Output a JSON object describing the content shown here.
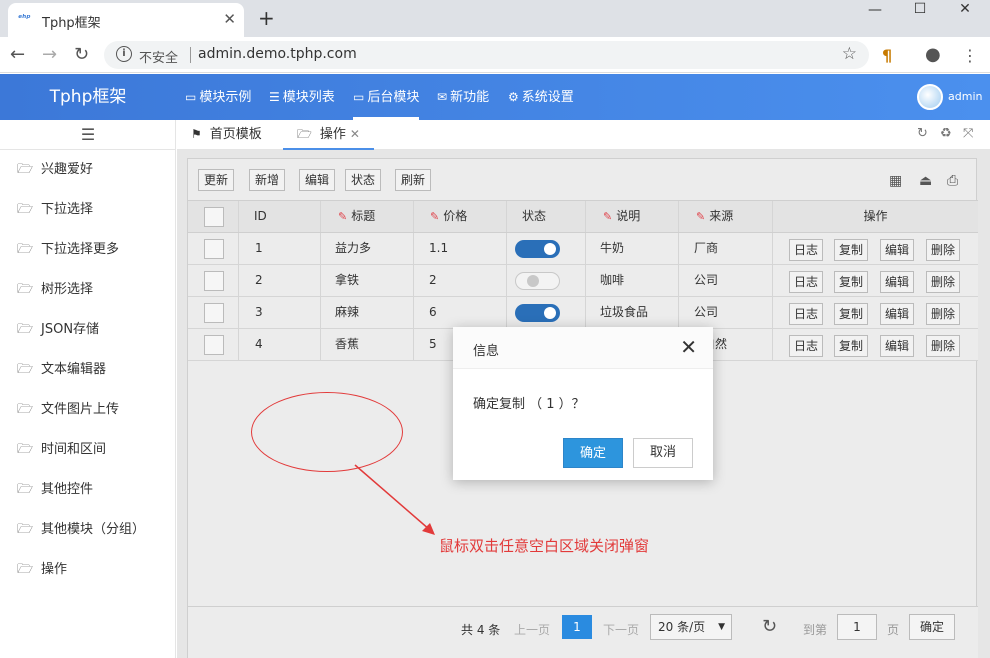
{
  "browser": {
    "tab_title": "Tphp框架",
    "tab_favicon": "ᵉʰᵖ",
    "new_tab": "+",
    "security_label": "不安全",
    "url": "admin.demo.tphp.com",
    "window_buttons": {
      "minimize": "—",
      "maximize": "☐",
      "close": "✕"
    }
  },
  "app": {
    "logo": "Tphp框架",
    "topnav": [
      {
        "label": "模块示例",
        "icon": "monitor-icon"
      },
      {
        "label": "模块列表",
        "icon": "list-icon"
      },
      {
        "label": "后台模块",
        "icon": "laptop-icon"
      },
      {
        "label": "新功能",
        "icon": "envelope-open-icon"
      },
      {
        "label": "系统设置",
        "icon": "gear-icon"
      }
    ],
    "active_topnav": "后台模块",
    "user": "admin",
    "accent_color": "#3c78d8"
  },
  "sidebar": {
    "items": [
      {
        "label": "兴趣爱好"
      },
      {
        "label": "下拉选择"
      },
      {
        "label": "下拉选择更多"
      },
      {
        "label": "树形选择"
      },
      {
        "label": "JSON存储"
      },
      {
        "label": "文本编辑器"
      },
      {
        "label": "文件图片上传"
      },
      {
        "label": "时间和区间"
      },
      {
        "label": "其他控件"
      },
      {
        "label": "其他模块（分组）"
      },
      {
        "label": "操作"
      }
    ]
  },
  "page_tabs": [
    {
      "label": "首页模板",
      "icon": "flag-icon"
    },
    {
      "label": "操作",
      "icon": "folder-open-icon",
      "closable": true
    }
  ],
  "toolbar": {
    "buttons": [
      "更新",
      "新增",
      "编辑",
      "状态",
      "刷新"
    ]
  },
  "table": {
    "columns": [
      "ID",
      "标题",
      "价格",
      "状态",
      "说明",
      "来源",
      "操作"
    ],
    "rows": [
      {
        "id": "1",
        "title": "益力多",
        "price": "1.1",
        "status": true,
        "desc": "牛奶",
        "source": "厂商"
      },
      {
        "id": "2",
        "title": "拿铁",
        "price": "2",
        "status": false,
        "desc": "咖啡",
        "source": "公司"
      },
      {
        "id": "3",
        "title": "麻辣",
        "price": "6",
        "status": true,
        "desc": "垃圾食品",
        "source": "公司"
      },
      {
        "id": "4",
        "title": "香蕉",
        "price": "5",
        "status": true,
        "desc": "",
        "source": "自然"
      }
    ],
    "actions": [
      "日志",
      "复制",
      "编辑",
      "删除"
    ]
  },
  "pager": {
    "total": "共 4 条",
    "prev": "上一页",
    "current": "1",
    "next": "下一页",
    "page_size": "20 条/页",
    "goto_label": "到第",
    "goto_value": "1",
    "page_unit": "页",
    "confirm": "确定"
  },
  "dialog": {
    "title": "信息",
    "message": "确定复制 （ 1 ）？",
    "ok": "确定",
    "cancel": "取消"
  },
  "annotation": {
    "text": "鼠标双击任意空白区域关闭弹窗",
    "color": "#e23a3a"
  }
}
